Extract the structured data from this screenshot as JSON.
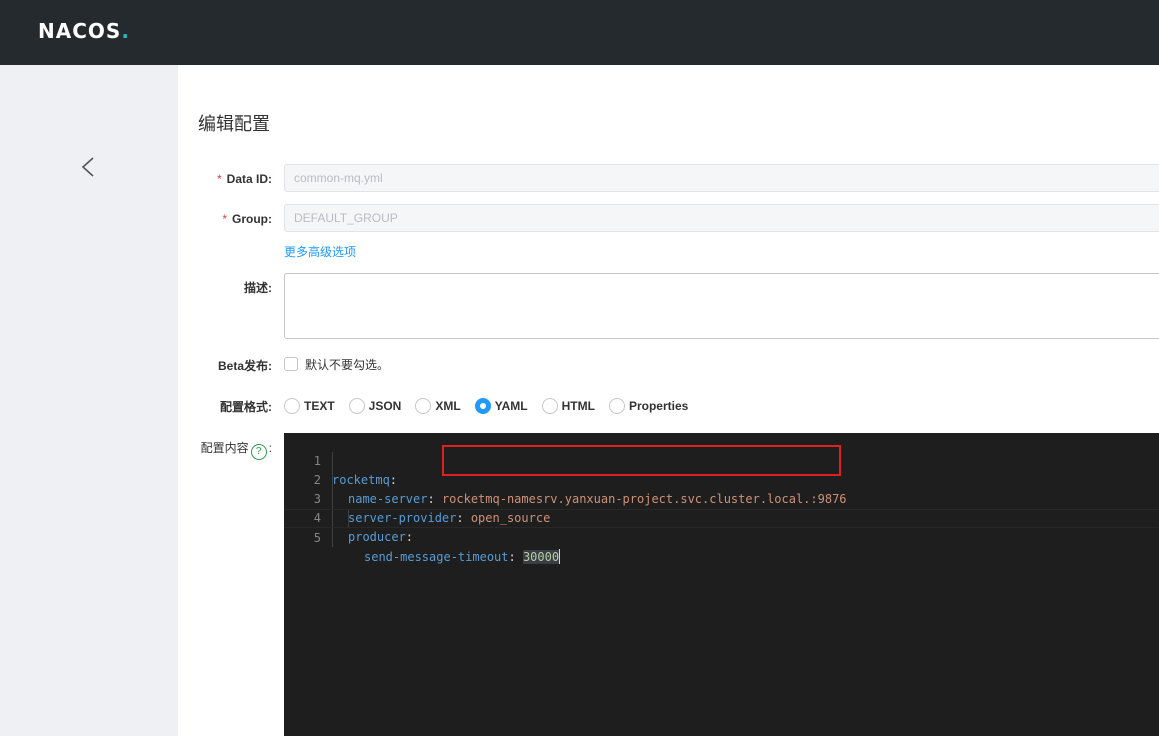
{
  "header": {
    "logo_main": "NACOS",
    "logo_dot": "."
  },
  "page": {
    "title": "编辑配置"
  },
  "form": {
    "data_id": {
      "label": "Data ID:",
      "required": "*",
      "value": "common-mq.yml"
    },
    "group": {
      "label": "Group:",
      "required": "*",
      "value": "DEFAULT_GROUP"
    },
    "advanced_link": "更多高级选项",
    "description": {
      "label": "描述:"
    },
    "beta": {
      "label": "Beta发布:",
      "checkbox_text": "默认不要勾选。"
    },
    "format": {
      "label": "配置格式:",
      "options": [
        "TEXT",
        "JSON",
        "XML",
        "YAML",
        "HTML",
        "Properties"
      ],
      "selected": "YAML"
    },
    "content": {
      "label_prefix": "配置内容",
      "help": "?",
      "label_suffix": ":"
    }
  },
  "editor": {
    "line_numbers": [
      "1",
      "2",
      "3",
      "4",
      "5"
    ],
    "lines": [
      {
        "key": "rocketmq",
        "sep": ":",
        "value": ""
      },
      {
        "key": "name-server",
        "sep": ": ",
        "value": "rocketmq-namesrv.yanxuan-project.svc.cluster.local.:9876"
      },
      {
        "key": "server-provider",
        "sep": ": ",
        "value": "open_source"
      },
      {
        "key": "producer",
        "sep": ":",
        "value": ""
      },
      {
        "key": "send-message-timeout",
        "sep": ": ",
        "value": "30000"
      }
    ]
  },
  "colors": {
    "accent": "#209bfa",
    "header_bg": "#252a2f",
    "highlight_box": "#e02020"
  }
}
